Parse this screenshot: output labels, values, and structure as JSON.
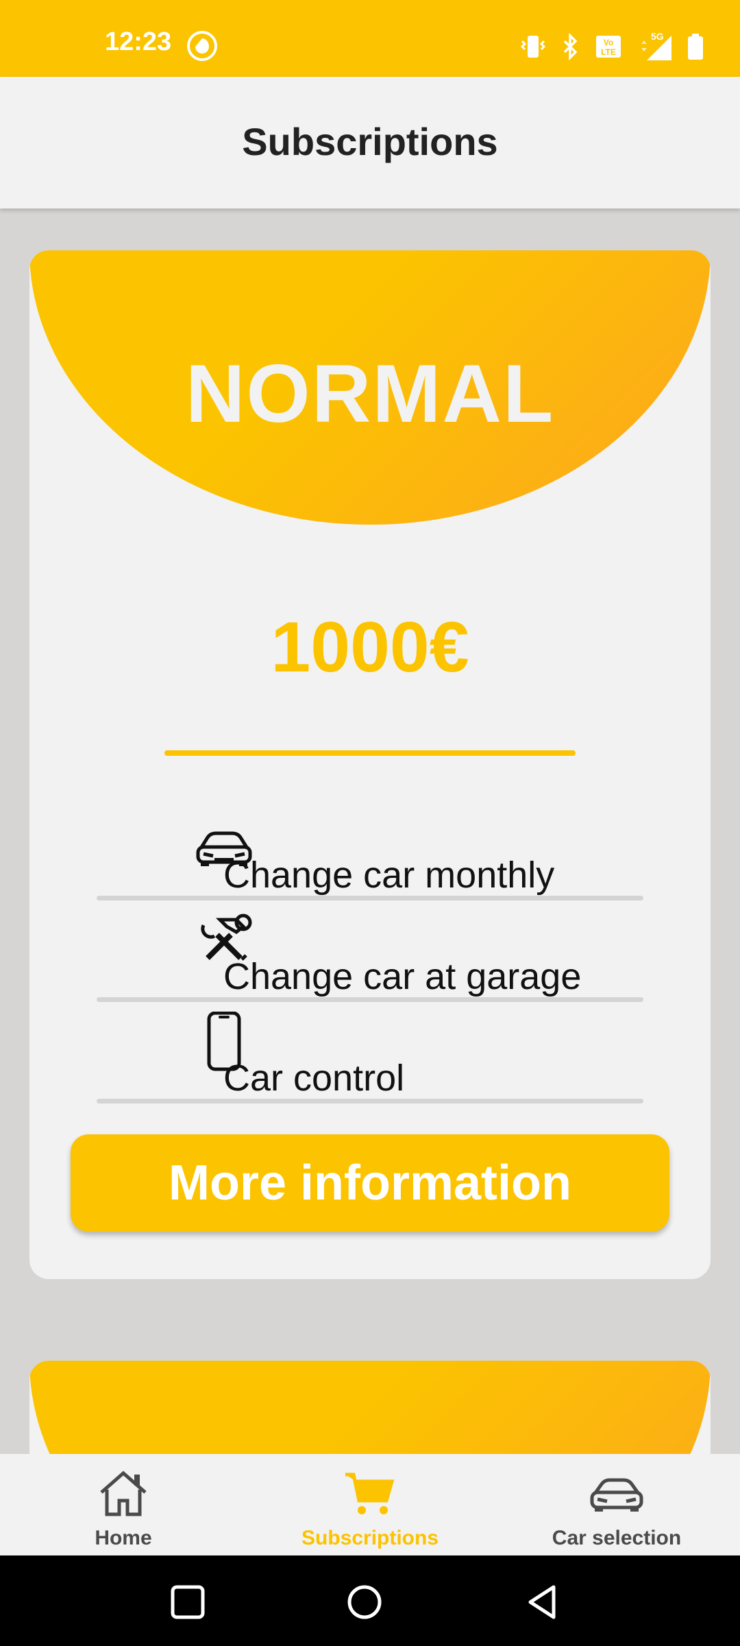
{
  "status_bar": {
    "time": "12:23",
    "network": "5G",
    "volte": "Vo LTE"
  },
  "app_bar": {
    "title": "Subscriptions"
  },
  "plan": {
    "name": "NORMAL",
    "price": "1000€",
    "features": [
      {
        "label": "Change car monthly",
        "icon": "car-icon"
      },
      {
        "label": "Change car at garage",
        "icon": "tools-icon"
      },
      {
        "label": "Car control",
        "icon": "phone-icon"
      }
    ],
    "button_label": "More information"
  },
  "bottom_nav": {
    "items": [
      {
        "label": "Home",
        "icon": "home-icon",
        "active": false
      },
      {
        "label": "Subscriptions",
        "icon": "cart-icon",
        "active": true
      },
      {
        "label": "Car selection",
        "icon": "car-icon",
        "active": false
      }
    ]
  },
  "colors": {
    "accent": "#fbc300",
    "accent_dark": "#fda61f",
    "background": "#d6d5d4",
    "surface": "#f2f2f2"
  }
}
